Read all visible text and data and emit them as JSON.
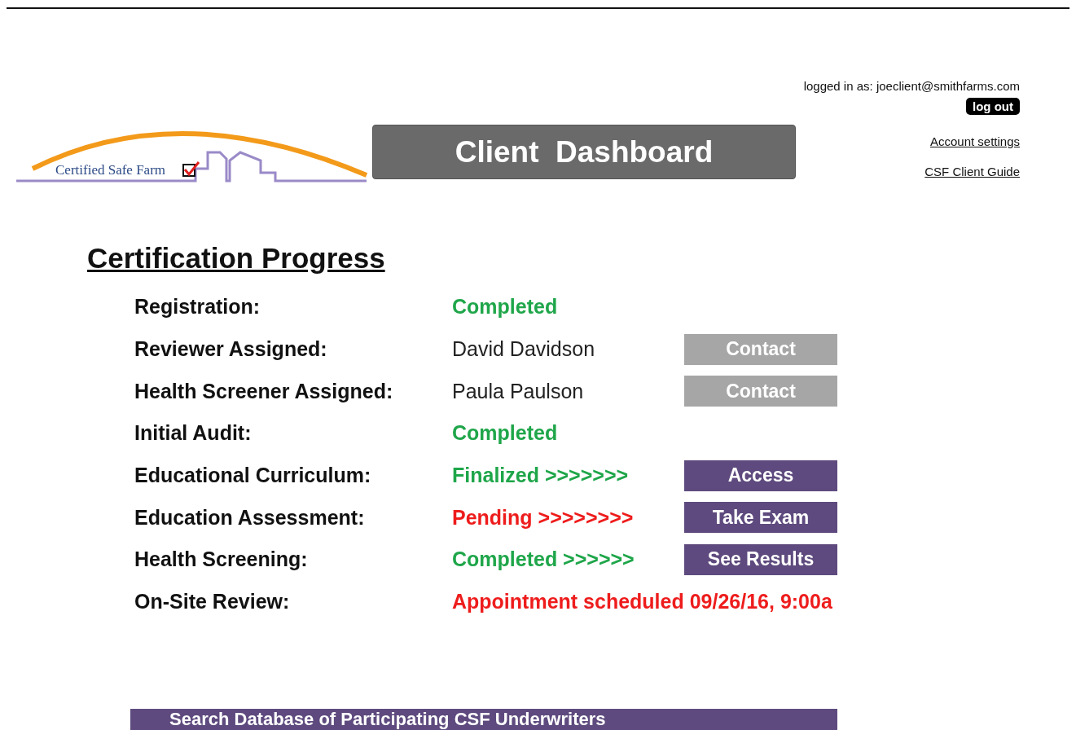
{
  "header": {
    "logo_text": "Certified Safe Farm",
    "title": "Client  Dashboard",
    "user": "logged in as: joeclient@smithfarms.com",
    "logout": "log out",
    "links": [
      "Account settings",
      "CSF Client Guide"
    ]
  },
  "progress": {
    "heading": "Certification Progress",
    "rows": [
      {
        "label": "Registration:",
        "value": "Completed",
        "kind": "done"
      },
      {
        "label": "Reviewer Assigned:",
        "value": "David Davidson",
        "kind": "plain",
        "button": {
          "label": "Contact",
          "kind": "muted"
        }
      },
      {
        "label": "Health Screener Assigned:",
        "value": "Paula Paulson",
        "kind": "plain",
        "button": {
          "label": "Contact",
          "kind": "muted"
        }
      },
      {
        "label": "Initial Audit:",
        "value": "Completed",
        "kind": "done"
      },
      {
        "label": "Educational Curriculum:",
        "value": "Finalized >>>>>>>",
        "kind": "done",
        "button": {
          "label": "Access",
          "kind": "primary"
        }
      },
      {
        "label": "Education Assessment:",
        "value": "Pending >>>>>>>>",
        "kind": "pending",
        "button": {
          "label": "Take Exam",
          "kind": "primary"
        }
      },
      {
        "label": "Health Screening:",
        "value": "Completed >>>>>>",
        "kind": "done",
        "button": {
          "label": "See Results",
          "kind": "primary"
        }
      },
      {
        "label": "On-Site Review:",
        "value": "Appointment scheduled 09/26/16, 9:00a",
        "kind": "pending"
      }
    ]
  },
  "search_bar": {
    "label": "Search Database of Participating CSF Underwriters"
  }
}
